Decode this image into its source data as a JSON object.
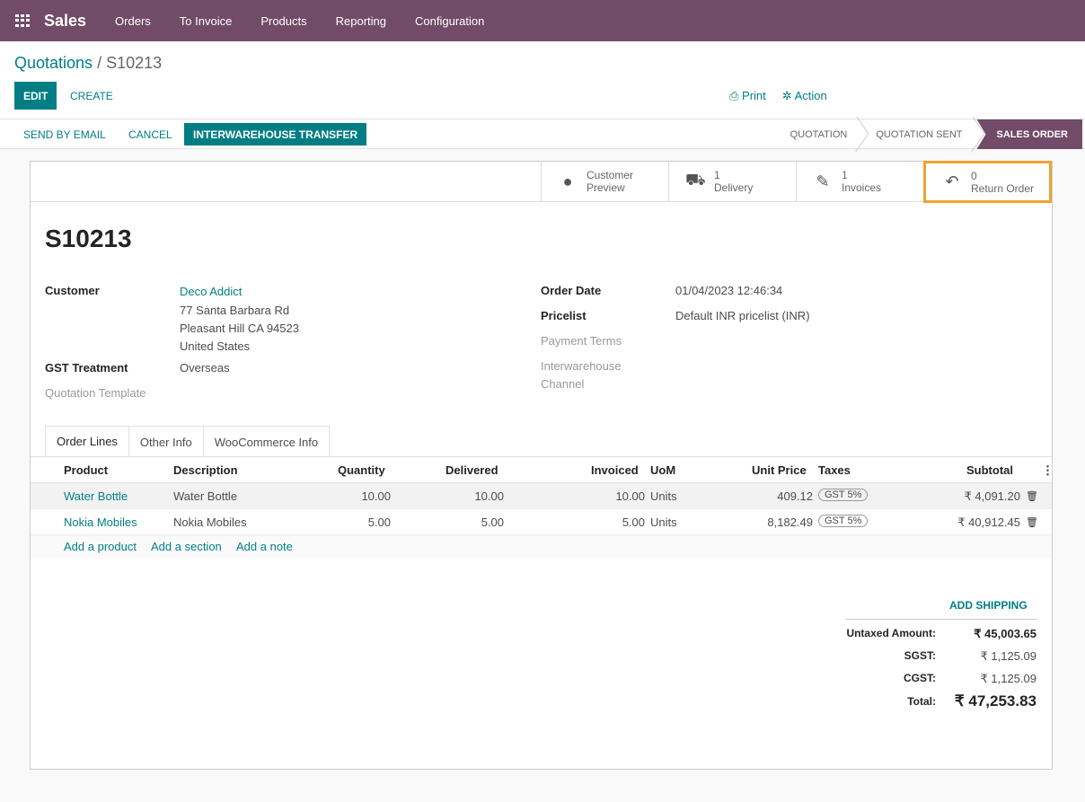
{
  "topbar": {
    "app_name": "Sales",
    "menu": [
      "Orders",
      "To Invoice",
      "Products",
      "Reporting",
      "Configuration"
    ]
  },
  "breadcrumb": {
    "parent": "Quotations",
    "separator": "/",
    "current": "S10213"
  },
  "actions": {
    "edit": "EDIT",
    "create": "CREATE",
    "print": "Print",
    "action": "Action"
  },
  "statusbar": {
    "buttons": [
      "SEND BY EMAIL",
      "CANCEL",
      "INTERWAREHOUSE TRANSFER"
    ],
    "stages": [
      "QUOTATION",
      "QUOTATION SENT",
      "SALES ORDER"
    ],
    "active_stage": "SALES ORDER"
  },
  "smart_buttons": [
    {
      "icon": "globe-icon",
      "line1": "Customer",
      "line2": "Preview"
    },
    {
      "icon": "truck-icon",
      "line1": "1",
      "line2": "Delivery"
    },
    {
      "icon": "pencil-square-icon",
      "line1": "1",
      "line2": "Invoices"
    },
    {
      "icon": "reply-icon",
      "line1": "0",
      "line2": "Return Order"
    }
  ],
  "order": {
    "name": "S10213",
    "customer_label": "Customer",
    "customer_name": "Deco Addict",
    "address": [
      "77 Santa Barbara Rd",
      "Pleasant Hill CA 94523",
      "United States"
    ],
    "gst_label": "GST Treatment",
    "gst_value": "Overseas",
    "template_label": "Quotation Template",
    "order_date_label": "Order Date",
    "order_date": "01/04/2023 12:46:34",
    "pricelist_label": "Pricelist",
    "pricelist": "Default INR pricelist (INR)",
    "payment_terms_label": "Payment Terms",
    "interwarehouse_label_1": "Interwarehouse",
    "interwarehouse_label_2": "Channel"
  },
  "tabs": [
    "Order Lines",
    "Other Info",
    "WooCommerce Info"
  ],
  "lines": {
    "headers": [
      "Product",
      "Description",
      "Quantity",
      "Delivered",
      "Invoiced",
      "UoM",
      "Unit Price",
      "Taxes",
      "Subtotal"
    ],
    "rows": [
      {
        "product": "Water Bottle",
        "description": "Water Bottle",
        "quantity": "10.00",
        "delivered": "10.00",
        "invoiced": "10.00",
        "uom": "Units",
        "unit_price": "409.12",
        "taxes": "GST 5%",
        "subtotal": "₹ 4,091.20"
      },
      {
        "product": "Nokia Mobiles",
        "description": "Nokia Mobiles",
        "quantity": "5.00",
        "delivered": "5.00",
        "invoiced": "5.00",
        "uom": "Units",
        "unit_price": "8,182.49",
        "taxes": "GST 5%",
        "subtotal": "₹ 40,912.45"
      }
    ],
    "add_product": "Add a product",
    "add_section": "Add a section",
    "add_note": "Add a note"
  },
  "totals": {
    "add_shipping": "ADD SHIPPING",
    "untaxed_label": "Untaxed Amount:",
    "untaxed": "₹ 45,003.65",
    "sgst_label": "SGST:",
    "sgst": "₹ 1,125.09",
    "cgst_label": "CGST:",
    "cgst": "₹ 1,125.09",
    "total_label": "Total:",
    "total": "₹ 47,253.83"
  },
  "colors": {
    "brand": "#714b67",
    "accent": "#017e84",
    "highlight": "#f0a330"
  }
}
